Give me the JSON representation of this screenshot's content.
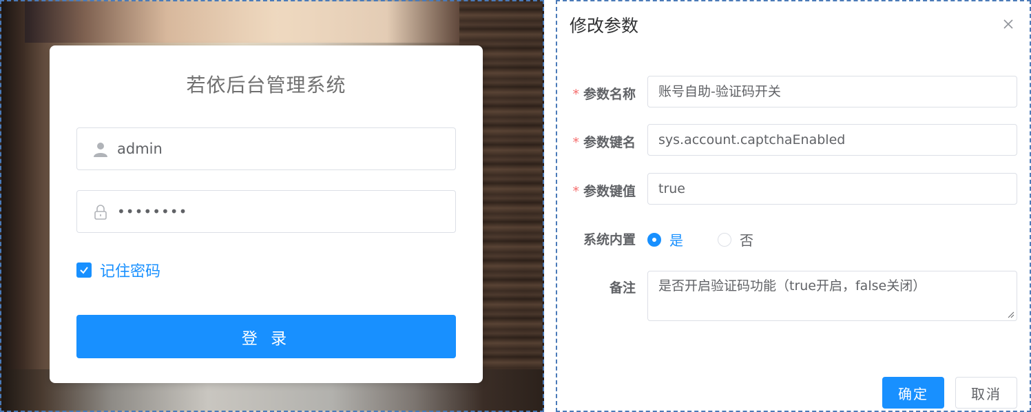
{
  "login": {
    "title": "若依后台管理系统",
    "username_value": "admin",
    "password_value": "••••••••",
    "remember_label": "记住密码",
    "remember_checked": true,
    "submit_label": "登 录",
    "accent": "#1890ff",
    "icons": {
      "user": "user-icon",
      "password": "lock-icon",
      "checkbox": "checkmark-icon"
    }
  },
  "dialog": {
    "title": "修改参数",
    "close_icon": "close-icon",
    "required_mark": "*",
    "fields": {
      "name_label": "参数名称",
      "name_value": "账号自助-验证码开关",
      "key_label": "参数键名",
      "key_value": "sys.account.captchaEnabled",
      "value_label": "参数键值",
      "value_value": "true",
      "builtin_label": "系统内置",
      "builtin_options": [
        "是",
        "否"
      ],
      "builtin_selected": "是",
      "remark_label": "备注",
      "remark_value": "是否开启验证码功能（true开启，false关闭）"
    },
    "buttons": {
      "confirm": "确定",
      "cancel": "取消"
    },
    "colors": {
      "primary": "#1890ff",
      "required": "#f56c6c",
      "border": "#dcdfe6"
    }
  }
}
